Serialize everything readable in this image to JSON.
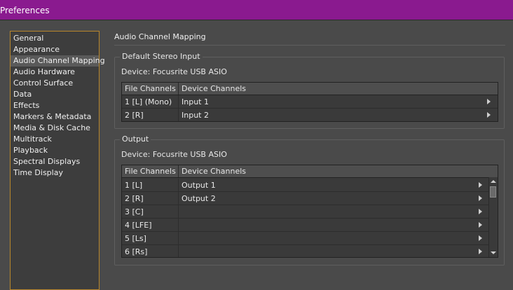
{
  "window": {
    "title": "Preferences"
  },
  "sidebar": {
    "items": [
      {
        "label": "General"
      },
      {
        "label": "Appearance"
      },
      {
        "label": "Audio Channel Mapping",
        "selected": true
      },
      {
        "label": "Audio Hardware"
      },
      {
        "label": "Control Surface"
      },
      {
        "label": "Data"
      },
      {
        "label": "Effects"
      },
      {
        "label": "Markers & Metadata"
      },
      {
        "label": "Media & Disk Cache"
      },
      {
        "label": "Multitrack"
      },
      {
        "label": "Playback"
      },
      {
        "label": "Spectral Displays"
      },
      {
        "label": "Time Display"
      }
    ]
  },
  "main": {
    "title": "Audio Channel Mapping",
    "input": {
      "group_title": "Default Stereo Input",
      "device": "Device: Focusrite USB ASIO",
      "columns": [
        "File Channels",
        "Device Channels"
      ],
      "rows": [
        {
          "file": "1 [L] (Mono)",
          "device": "Input 1"
        },
        {
          "file": "2 [R]",
          "device": "Input 2"
        }
      ]
    },
    "output": {
      "group_title": "Output",
      "device": "Device: Focusrite USB ASIO",
      "columns": [
        "File Channels",
        "Device Channels"
      ],
      "rows": [
        {
          "file": "1 [L]",
          "device": "Output 1"
        },
        {
          "file": "2 [R]",
          "device": "Output 2"
        },
        {
          "file": "3 [C]",
          "device": ""
        },
        {
          "file": "4 [LFE]",
          "device": ""
        },
        {
          "file": "5 [Ls]",
          "device": ""
        },
        {
          "file": "6 [Rs]",
          "device": ""
        }
      ]
    }
  },
  "colors": {
    "accent_titlebar": "#8a1a8f",
    "selection_border": "#b8862b",
    "background": "#4a4a4a"
  }
}
